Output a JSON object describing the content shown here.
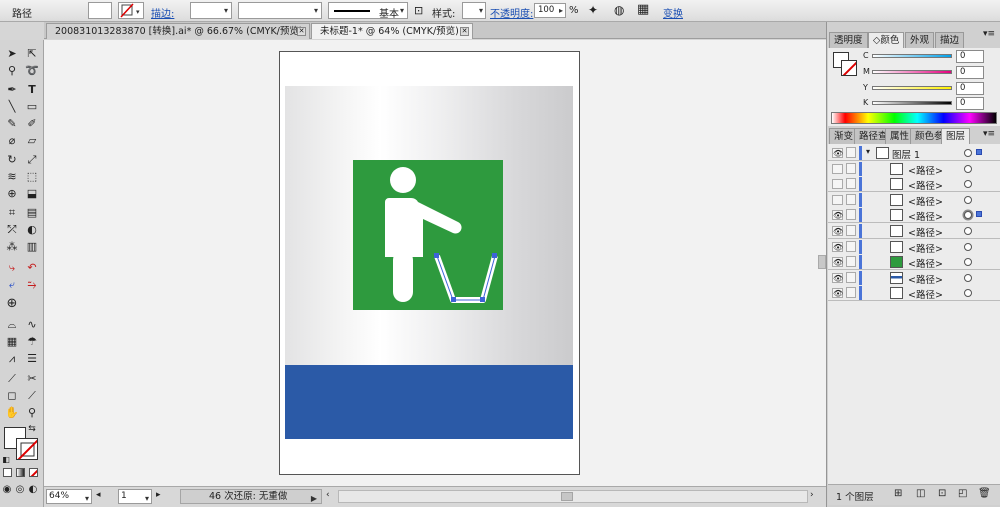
{
  "control_bar": {
    "object_type": "路径",
    "stroke_label": "描边:",
    "stroke_profile": "基本",
    "style_label": "样式:",
    "opacity_label": "不透明度:",
    "opacity_value": "100",
    "opacity_unit": "%",
    "transform_label": "变换"
  },
  "document_tabs": [
    {
      "label": "20083101328387​0 [转换].ai* @ 66.67% (CMYK/预览)",
      "active": false
    },
    {
      "label": "未标题-1* @ 64% (CMYK/预览)",
      "active": true
    }
  ],
  "status_bar": {
    "zoom": "64%",
    "artboard": "1",
    "undo_text": "46 次还原: 无重做"
  },
  "color_panel": {
    "tabs": [
      "透明度",
      "颜色",
      "外观",
      "描边"
    ],
    "active_tab": "颜色",
    "channels": [
      {
        "label": "C",
        "value": "0",
        "color": "#00a0e9"
      },
      {
        "label": "M",
        "value": "0",
        "color": "#e4007f"
      },
      {
        "label": "Y",
        "value": "0",
        "color": "#fff100"
      },
      {
        "label": "K",
        "value": "0",
        "color": "#000000"
      }
    ]
  },
  "layers_panel": {
    "tabs": [
      "渐变",
      "路径查",
      "属性",
      "颜色参",
      "图层"
    ],
    "active_tab": "图层",
    "footer": "1 个图层",
    "rows": [
      {
        "name": "图层 1",
        "visible": true,
        "top": true,
        "thumb": "layer"
      },
      {
        "name": "<路径>",
        "visible": false,
        "thumb": "white"
      },
      {
        "name": "<路径>",
        "visible": false,
        "thumb": "white"
      },
      {
        "name": "<路径>",
        "visible": false,
        "thumb": "white"
      },
      {
        "name": "<路径>",
        "visible": true,
        "thumb": "white",
        "selected": true
      },
      {
        "name": "<路径>",
        "visible": true,
        "thumb": "white"
      },
      {
        "name": "<路径>",
        "visible": true,
        "thumb": "white"
      },
      {
        "name": "<路径>",
        "visible": true,
        "thumb": "green"
      },
      {
        "name": "<路径>",
        "visible": true,
        "thumb": "grad"
      },
      {
        "name": "<路径>",
        "visible": true,
        "thumb": "white"
      }
    ]
  },
  "artwork_colors": {
    "green": "#2e9a3e",
    "blue": "#2b5aa7",
    "selection": "#3d63d8"
  }
}
